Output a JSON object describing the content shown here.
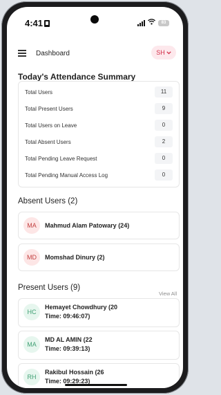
{
  "status_bar": {
    "time": "4:41",
    "battery": "83"
  },
  "header": {
    "title": "Dashboard",
    "profile_initials": "SH"
  },
  "summary": {
    "title": "Today's Attendance Summary",
    "rows": [
      {
        "label": "Total Users",
        "value": "11"
      },
      {
        "label": "Total Present Users",
        "value": "9"
      },
      {
        "label": "Total Users on Leave",
        "value": "0"
      },
      {
        "label": "Total Absent Users",
        "value": "2"
      },
      {
        "label": "Total Pending Leave Request",
        "value": "0"
      },
      {
        "label": "Total Pending Manual Access Log",
        "value": "0"
      }
    ]
  },
  "absent": {
    "title": "Absent Users (2)",
    "users": [
      {
        "initials": "MA",
        "name": "Mahmud Alam Patowary (24)"
      },
      {
        "initials": "MD",
        "name": "Momshad Dinury (2)"
      }
    ]
  },
  "present": {
    "title": "Present Users (9)",
    "view_all": "View All",
    "users": [
      {
        "initials": "HC",
        "name": "Hemayet Chowdhury (20",
        "time": "Time: 09:46:07)"
      },
      {
        "initials": "MA",
        "name": "MD AL AMIN (22",
        "time": "Time: 09:39:13)"
      },
      {
        "initials": "RH",
        "name": "Rakibul Hossain (26",
        "time": "Time: 09:29:23)"
      }
    ]
  },
  "colors": {
    "accent_red": "#d32f4a",
    "absent_avatar_bg": "#fde6e6",
    "present_avatar_bg": "#e6f6ee"
  },
  "icons": {
    "menu": "menu-icon",
    "profile_dropdown": "chevron-down-icon",
    "signal": "signal-icon",
    "wifi": "wifi-icon",
    "battery": "battery-icon",
    "sim": "sim-icon"
  }
}
